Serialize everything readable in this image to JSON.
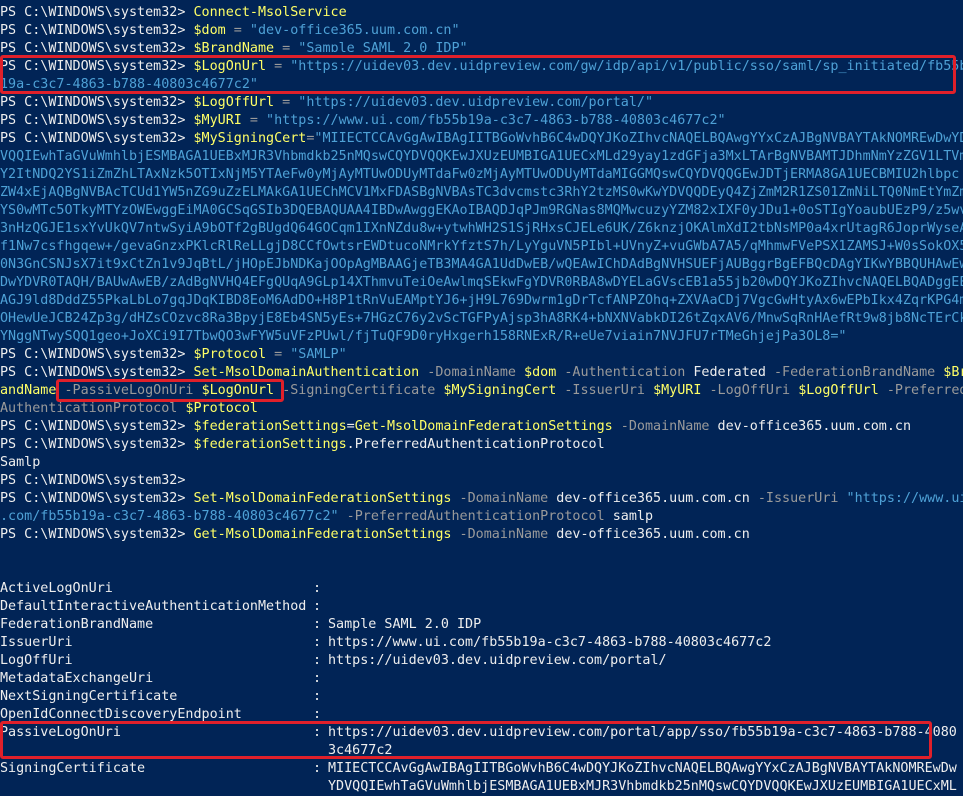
{
  "prompt": "PS C:\\WINDOWS\\system32> ",
  "commands": {
    "connect": "Connect-MsolService",
    "dom_var": "$dom",
    "dom_val": "\"dev-office365.uum.com.cn\"",
    "brand_var": "$BrandName",
    "brand_val": "\"Sample SAML 2.0 IDP\"",
    "logon_var": "$LogOnUrl",
    "logon_val": "\"https://uidev03.dev.uidpreview.com/gw/idp/api/v1/public/sso/saml/sp_initiated/fb55b",
    "logon_val_cont": "19a-c3c7-4863-b788-40803c4677c2\"",
    "logoff_var": "$LogOffUrl",
    "logoff_val": "\"https://uidev03.dev.uidpreview.com/portal/\"",
    "myuri_var": "$MyURI",
    "myuri_val": "\"https://www.ui.com/fb55b19a-c3c7-4863-b788-40803c4677c2\"",
    "cert_var": "$MySigningCert",
    "cert_lines": [
      "\"MIIECTCCAvGgAwIBAgIITBGoWvhB6C4wDQYJKoZIhvcNAQELBQAwgYYxCzAJBgNVBAYTAkNOMREwDwYD",
      "VQQIEwhTaGVuWmhlbjESMBAGA1UEBxMJR3Vhbmdkb25nMQswCQYDVQQKEwJXUzEUMBIGA1UECxMLd29yay1zdGFja3MxLTArBgNVBAMTJDhmNmYzZGV1LTVm",
      "Y2ItNDQ2YS1iZmZhLTAxNzk5OTIxNjM5YTAeFw0yMjAyMTUwODUyMTdaFw0zMjAyMTUwODUyMTdaMIGGMQswCQYDVQQGEwJDTjERMA8GA1UECBMIU2hlbpc",
      "ZW4xEjAQBgNVBAcTCUd1YW5nZG9uZzELMAkGA1UEChMCV1MxFDASBgNVBAsTC3dvcmstc3RhY2tzMS0wKwYDVQQDEyQ4ZjZmM2R1ZS01ZmNiLTQ0NmEtYmZm",
      "YS0wMTc5OTkyMTYzOWEwggEiMA0GCSqGSIb3DQEBAQUAA4IBDwAwggEKAoIBAQDJqPJm9RGNas8MQMwcuzyYZM82xIXF0yJDu1+0oSTIgYoaubUEzP9/z5wv",
      "3nHzQGJE1sxYvUkQV7ntwSyiA9bOTf2gBUgdQ64GOCqm1IXnNZdu8w+ytwhWH2S1SjRHxsCJELe6UK/Z6knzjOKAlmXdI2tbNsMP0a4xrUtagR6JoprWyseA",
      "f1Nw7csfhgqew+/gevaGnzxPKlcRlReLLgjD8CCfOwtsrEWDtucoNMrkYfztS7h/LyYguVN5PIbl+UVnyZ+vuGWbA7A5/qMhmwFVePSX1ZAMSJ+W0sSokOX5",
      "0N3GnCSNJsX7it9xCtZn1v9JqBtL/jHOpEJbNDKajOOpAgMBAAGjeTB3MA4GA1UdDwEB/wQEAwIChDAdBgNVHSUEFjAUBggrBgEFBQcDAgYIKwYBBQUHAwEw",
      "DwYDVR0TAQH/BAUwAwEB/zAdBgNVHQ4EFgQUqA9GLp14XThmvuTeiOeAwlmqSEkwFgYDVR0RBA8wDYELaGVscEB1a55jb20wDQYJKoZIhvcNAQELBQADggEE",
      "AGJ9ld8DddZ55PkaLbLo7gqJDqKIBD8EoM6AdDO+H8P1tRnVuEAMptYJ6+jH9L769Dwrm1gDrTcfANPZOhq+ZXVAaCDj7VgcGwHtyAx6wEPbIkx4ZqrKPG4m",
      "OHewUeJCB24Zp3g/dHZsCOzvc8Ra3BpyjE8Eb4SN5yEs+7HGzC76y2vScTGFPyAjsp3hA8RK4+bNXNVabkDI26tZqxAV6/MnwSqRnHAefRt9w8jb8NcTErCk",
      "YNggNTwySQQ1geo+JoXCi9I7TbwQO3wFYW5uVFzPUwl/fjTuQF9D0ryHxgerh158RNExR/R+eUe7viain7NVJFU7rTMeGhjejPa3OL8=\""
    ],
    "protocol_var": "$Protocol",
    "protocol_val": "\"SAMLP\"",
    "setauth_cmd": "Set-MsolDomainAuthentication",
    "p_domainname": "-DomainName",
    "p_auth": "-Authentication",
    "auth_val": "Federated",
    "p_brand": "-FederationBrandName",
    "brand_var_end": "$Br",
    "brand_var_cont": "andName",
    "p_passive": "-PassiveLogOnUri",
    "p_signing": "-SigningCertificate",
    "p_issuer": "-IssuerUri",
    "p_logoff": "-LogOffUri",
    "p_preferred_a": "-Preferred",
    "p_preferred_b": "AuthenticationProtocol",
    "fed_var": "$federationSettings",
    "eq": "=",
    "getfed_cmd": "Get-MsolDomainFederationSettings",
    "domain_val": "dev-office365.uum.com.cn",
    "prop_access": ".PreferredAuthenticationProtocol",
    "result_samlp": "Samlp",
    "setfed_cmd": "Set-MsolDomainFederationSettings",
    "issuer_str_a": "\"https://www.ui",
    "issuer_str_b": ".com/fb55b19a-c3c7-4863-b788-40803c4677c2\"",
    "p_pref_full": "-PreferredAuthenticationProtocol",
    "samlp_lc": "samlp"
  },
  "properties": [
    {
      "name": "ActiveLogOnUri",
      "value": ""
    },
    {
      "name": "DefaultInteractiveAuthenticationMethod",
      "value": ""
    },
    {
      "name": "FederationBrandName",
      "value": "Sample SAML 2.0 IDP"
    },
    {
      "name": "IssuerUri",
      "value": "https://www.ui.com/fb55b19a-c3c7-4863-b788-40803c4677c2"
    },
    {
      "name": "LogOffUri",
      "value": "https://uidev03.dev.uidpreview.com/portal/"
    },
    {
      "name": "MetadataExchangeUri",
      "value": ""
    },
    {
      "name": "NextSigningCertificate",
      "value": ""
    },
    {
      "name": "OpenIdConnectDiscoveryEndpoint",
      "value": ""
    },
    {
      "name": "PassiveLogOnUri",
      "value": "https://uidev03.dev.uidpreview.com/portal/app/sso/fb55b19a-c3c7-4863-b788-4080",
      "value_cont": "3c4677c2"
    },
    {
      "name": "SigningCertificate",
      "value": "MIIECTCCAvGgAwIBAgIITBGoWvhB6C4wDQYJKoZIhvcNAQELBQAwgYYxCzAJBgNVBAYTAkNOMREwDw",
      "value_cont": "YDVQQIEwhTaGVuWmhlbjESMBAGA1UEBxMJR3Vhbmdkb25nMQswCQYDVQQKEwJXUzEUMBIGA1UECxML"
    }
  ],
  "colon": ":"
}
